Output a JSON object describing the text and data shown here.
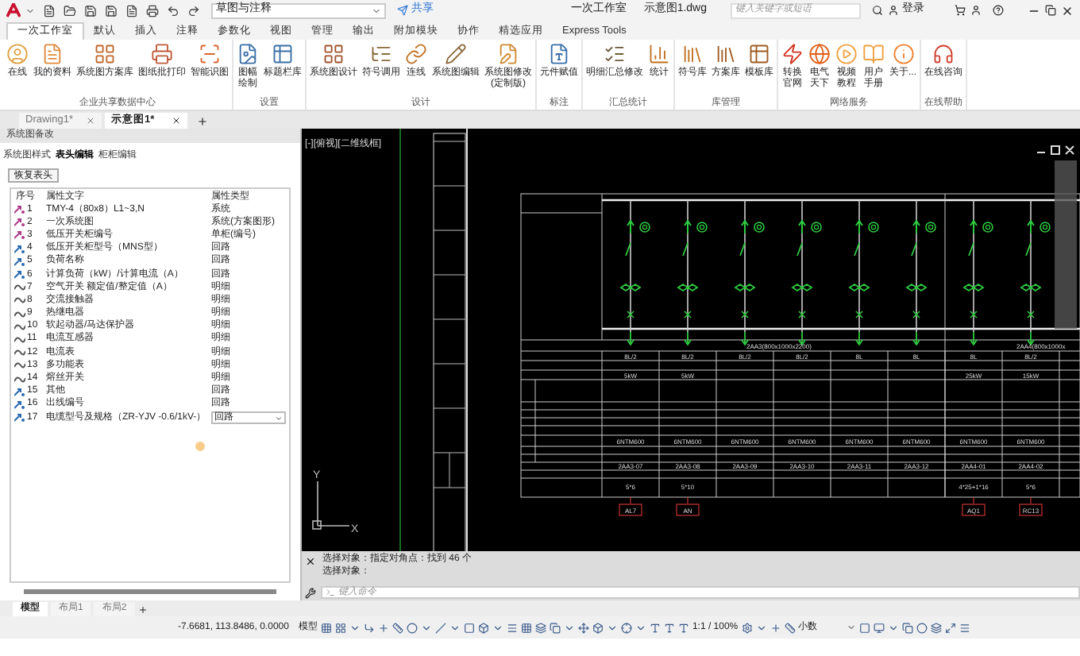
{
  "titlebar": {
    "workspace": "草图与注释",
    "share": "共享",
    "title": "一次工作室",
    "filename": "示意图1.dwg",
    "search_placeholder": "键入关键字或短语",
    "login": "登录"
  },
  "ribbon_tabs": [
    {
      "label": "一次工作室",
      "selected": true
    },
    {
      "label": "默认",
      "selected": false
    },
    {
      "label": "插入",
      "selected": false
    },
    {
      "label": "注释",
      "selected": false
    },
    {
      "label": "参数化",
      "selected": false
    },
    {
      "label": "视图",
      "selected": false
    },
    {
      "label": "管理",
      "selected": false
    },
    {
      "label": "输出",
      "selected": false
    },
    {
      "label": "附加模块",
      "selected": false
    },
    {
      "label": "协作",
      "selected": false
    },
    {
      "label": "精选应用",
      "selected": false
    },
    {
      "label": "Express Tools",
      "selected": false
    }
  ],
  "ribbon_groups": [
    {
      "title": "企业共享数据中心",
      "items": [
        {
          "label": "在线"
        },
        {
          "label": "我的资料"
        },
        {
          "label": "系统图方案库"
        },
        {
          "label": "图纸批打印"
        },
        {
          "label": "智能识图"
        }
      ]
    },
    {
      "title": "设置",
      "items": [
        {
          "label": "图幅绘制",
          "two_line": true
        },
        {
          "label": "标题栏库"
        }
      ]
    },
    {
      "title": "设计",
      "items": [
        {
          "label": "系统图设计"
        },
        {
          "label": "符号调用"
        },
        {
          "label": "连线"
        },
        {
          "label": "系统图编辑"
        },
        {
          "label": "系统图修改\n(定制版)"
        }
      ]
    },
    {
      "title": "标注",
      "items": [
        {
          "label": "元件赋值"
        }
      ]
    },
    {
      "title": "汇总统计",
      "items": [
        {
          "label": "明细汇总修改"
        },
        {
          "label": "统计"
        }
      ]
    },
    {
      "title": "库管理",
      "items": [
        {
          "label": "符号库"
        },
        {
          "label": "方案库"
        },
        {
          "label": "模板库"
        }
      ]
    },
    {
      "title": "网络服务",
      "items": [
        {
          "label": "转换官网",
          "two_line": true
        },
        {
          "label": "电气天下",
          "two_line": true
        },
        {
          "label": "视频教程",
          "two_line": true
        },
        {
          "label": "用户手册",
          "two_line": true
        },
        {
          "label": "关于..."
        }
      ]
    },
    {
      "title": "在线帮助",
      "items": [
        {
          "label": "在线咨询"
        }
      ]
    }
  ],
  "doc_tabs": [
    {
      "label": "Drawing1*",
      "selected": false
    },
    {
      "label": "示意图1*",
      "selected": true
    }
  ],
  "left_panel": {
    "title": "系统图备改",
    "tabs": [
      {
        "label": "系统图样式",
        "selected": false
      },
      {
        "label": "表头编辑",
        "selected": true
      },
      {
        "label": "柜柜编辑",
        "selected": false
      }
    ],
    "restore_button": "恢复表头",
    "columns": [
      "序号",
      "属性文字",
      "属性类型"
    ],
    "rows": [
      {
        "index": "1",
        "text": "TMY-4（80x8）L1~3,N",
        "type": "系统",
        "kind": "system",
        "selected": false
      },
      {
        "index": "2",
        "text": "一次系统图",
        "type": "系统(方案图形)",
        "kind": "system",
        "selected": false
      },
      {
        "index": "3",
        "text": "低压开关柜编号",
        "type": "单柜(编号)",
        "kind": "system",
        "selected": false
      },
      {
        "index": "4",
        "text": "低压开关柜型号（MNS型）",
        "type": "回路",
        "kind": "loop",
        "selected": false
      },
      {
        "index": "5",
        "text": "负荷名称",
        "type": "回路",
        "kind": "loop",
        "selected": false
      },
      {
        "index": "6",
        "text": "计算负荷（kW）/计算电流（A）",
        "type": "回路",
        "kind": "loop",
        "selected": false
      },
      {
        "index": "7",
        "text": "空气开关 额定值/整定值（A）",
        "type": "明细",
        "kind": "detail",
        "selected": false
      },
      {
        "index": "8",
        "text": "交流接触器",
        "type": "明细",
        "kind": "detail",
        "selected": false
      },
      {
        "index": "9",
        "text": "热继电器",
        "type": "明细",
        "kind": "detail",
        "selected": false
      },
      {
        "index": "10",
        "text": "软起动器/马达保护器",
        "type": "明细",
        "kind": "detail",
        "selected": false
      },
      {
        "index": "11",
        "text": "电流互感器",
        "type": "明细",
        "kind": "detail",
        "selected": false
      },
      {
        "index": "12",
        "text": "电流表",
        "type": "明细",
        "kind": "detail",
        "selected": false
      },
      {
        "index": "13",
        "text": "多功能表",
        "type": "明细",
        "kind": "detail",
        "selected": false
      },
      {
        "index": "14",
        "text": "熔丝开关",
        "type": "明细",
        "kind": "detail",
        "selected": false
      },
      {
        "index": "15",
        "text": "其他",
        "type": "回路",
        "kind": "loop",
        "selected": false
      },
      {
        "index": "16",
        "text": "出线编号",
        "type": "回路",
        "kind": "loop",
        "selected": false
      },
      {
        "index": "17",
        "text": "电缆型号及规格（ZR-YJV -0.6/1kV-）",
        "type": "回路",
        "kind": "loop",
        "selected": true
      }
    ]
  },
  "viewport": {
    "label": "[-][俯视][二维线框]",
    "ucs_x": "X",
    "ucs_y": "Y"
  },
  "schematic": {
    "cabinets": [
      "2AA3(800x1000x2200)",
      "2AA4(800x1000x"
    ],
    "columns": [
      {
        "circuit": "8L/2",
        "power": "5kW",
        "model": "6NTM600",
        "number": "2AA3-07",
        "cable": "5*6",
        "tag": "AL7"
      },
      {
        "circuit": "8L/2",
        "power": "5kW",
        "model": "6NTM600",
        "number": "2AA3-08",
        "cable": "5*10",
        "tag": "AN"
      },
      {
        "circuit": "8L/2",
        "model": "6NTM600",
        "number": "2AA3-09"
      },
      {
        "circuit": "8L/2",
        "model": "6NTM600",
        "number": "2AA3-10"
      },
      {
        "circuit": "8L",
        "model": "6NTM600",
        "number": "2AA3-11"
      },
      {
        "circuit": "8L",
        "model": "6NTM600",
        "number": "2AA3-12"
      },
      {
        "circuit": "8L",
        "power": "25kW",
        "model": "6NTM600",
        "number": "2AA4-01",
        "cable": "4*25+1*16",
        "tag": "AQ1"
      },
      {
        "circuit": "8L/2",
        "power": "15kW",
        "model": "6NTM600",
        "number": "2AA4-02",
        "cable": "5*6",
        "tag": "RC13"
      }
    ]
  },
  "command": {
    "history": [
      "选择对象：指定对角点：找到 46 个",
      "选择对象："
    ],
    "placeholder": "键入命令"
  },
  "layout_tabs": [
    {
      "label": "模型",
      "selected": true
    },
    {
      "label": "布局1",
      "selected": false
    },
    {
      "label": "布局2",
      "selected": false
    }
  ],
  "status_bar": {
    "coordinates": "-7.6681, 113.8486, 0.0000",
    "space": "模型",
    "scale": "1:1 / 100%",
    "units": "小数"
  }
}
